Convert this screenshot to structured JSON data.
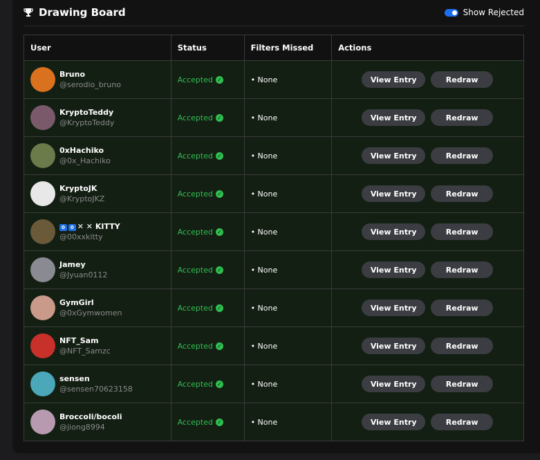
{
  "header": {
    "title": "Drawing Board",
    "toggle_label": "Show Rejected"
  },
  "table": {
    "columns": [
      "User",
      "Status",
      "Filters Missed",
      "Actions"
    ],
    "rows": [
      {
        "name": "Bruno",
        "handle": "@serodio_bruno",
        "status": "Accepted",
        "filters": "• None",
        "avatar_color": "#d9711f"
      },
      {
        "name": "KryptoTeddy",
        "handle": "@KryptoTeddy",
        "status": "Accepted",
        "filters": "• None",
        "avatar_color": "#7a5a6a"
      },
      {
        "name": "0xHachiko",
        "handle": "@0x_Hachiko",
        "status": "Accepted",
        "filters": "• None",
        "avatar_color": "#6b7b4a"
      },
      {
        "name": "KryptoJK",
        "handle": "@KryptoJKZ",
        "status": "Accepted",
        "filters": "• None",
        "avatar_color": "#e8e8e8"
      },
      {
        "name": "✕ ✕ KITTY",
        "name_tags": [
          "0",
          "0"
        ],
        "handle": "@00xxkitty",
        "status": "Accepted",
        "filters": "• None",
        "avatar_color": "#6a5a3a"
      },
      {
        "name": "Jamey",
        "handle": "@Jyuan0112",
        "status": "Accepted",
        "filters": "• None",
        "avatar_color": "#8a8a92"
      },
      {
        "name": "GymGirl",
        "handle": "@0xGymwomen",
        "status": "Accepted",
        "filters": "• None",
        "avatar_color": "#c99a8a"
      },
      {
        "name": "NFT_Sam",
        "handle": "@NFT_Samzc",
        "status": "Accepted",
        "filters": "• None",
        "avatar_color": "#c8302a"
      },
      {
        "name": "sensen",
        "handle": "@sensen70623158",
        "status": "Accepted",
        "filters": "• None",
        "avatar_color": "#4aa8b8"
      },
      {
        "name": "Broccoli/bocoli",
        "handle": "@jiong8994",
        "status": "Accepted",
        "filters": "• None",
        "avatar_color": "#b89ab0"
      }
    ],
    "view_label": "View Entry",
    "redraw_label": "Redraw"
  },
  "colors": {
    "accent": "#1d6ff2",
    "accepted": "#2fbf4f",
    "row_bg": "#141f14"
  }
}
